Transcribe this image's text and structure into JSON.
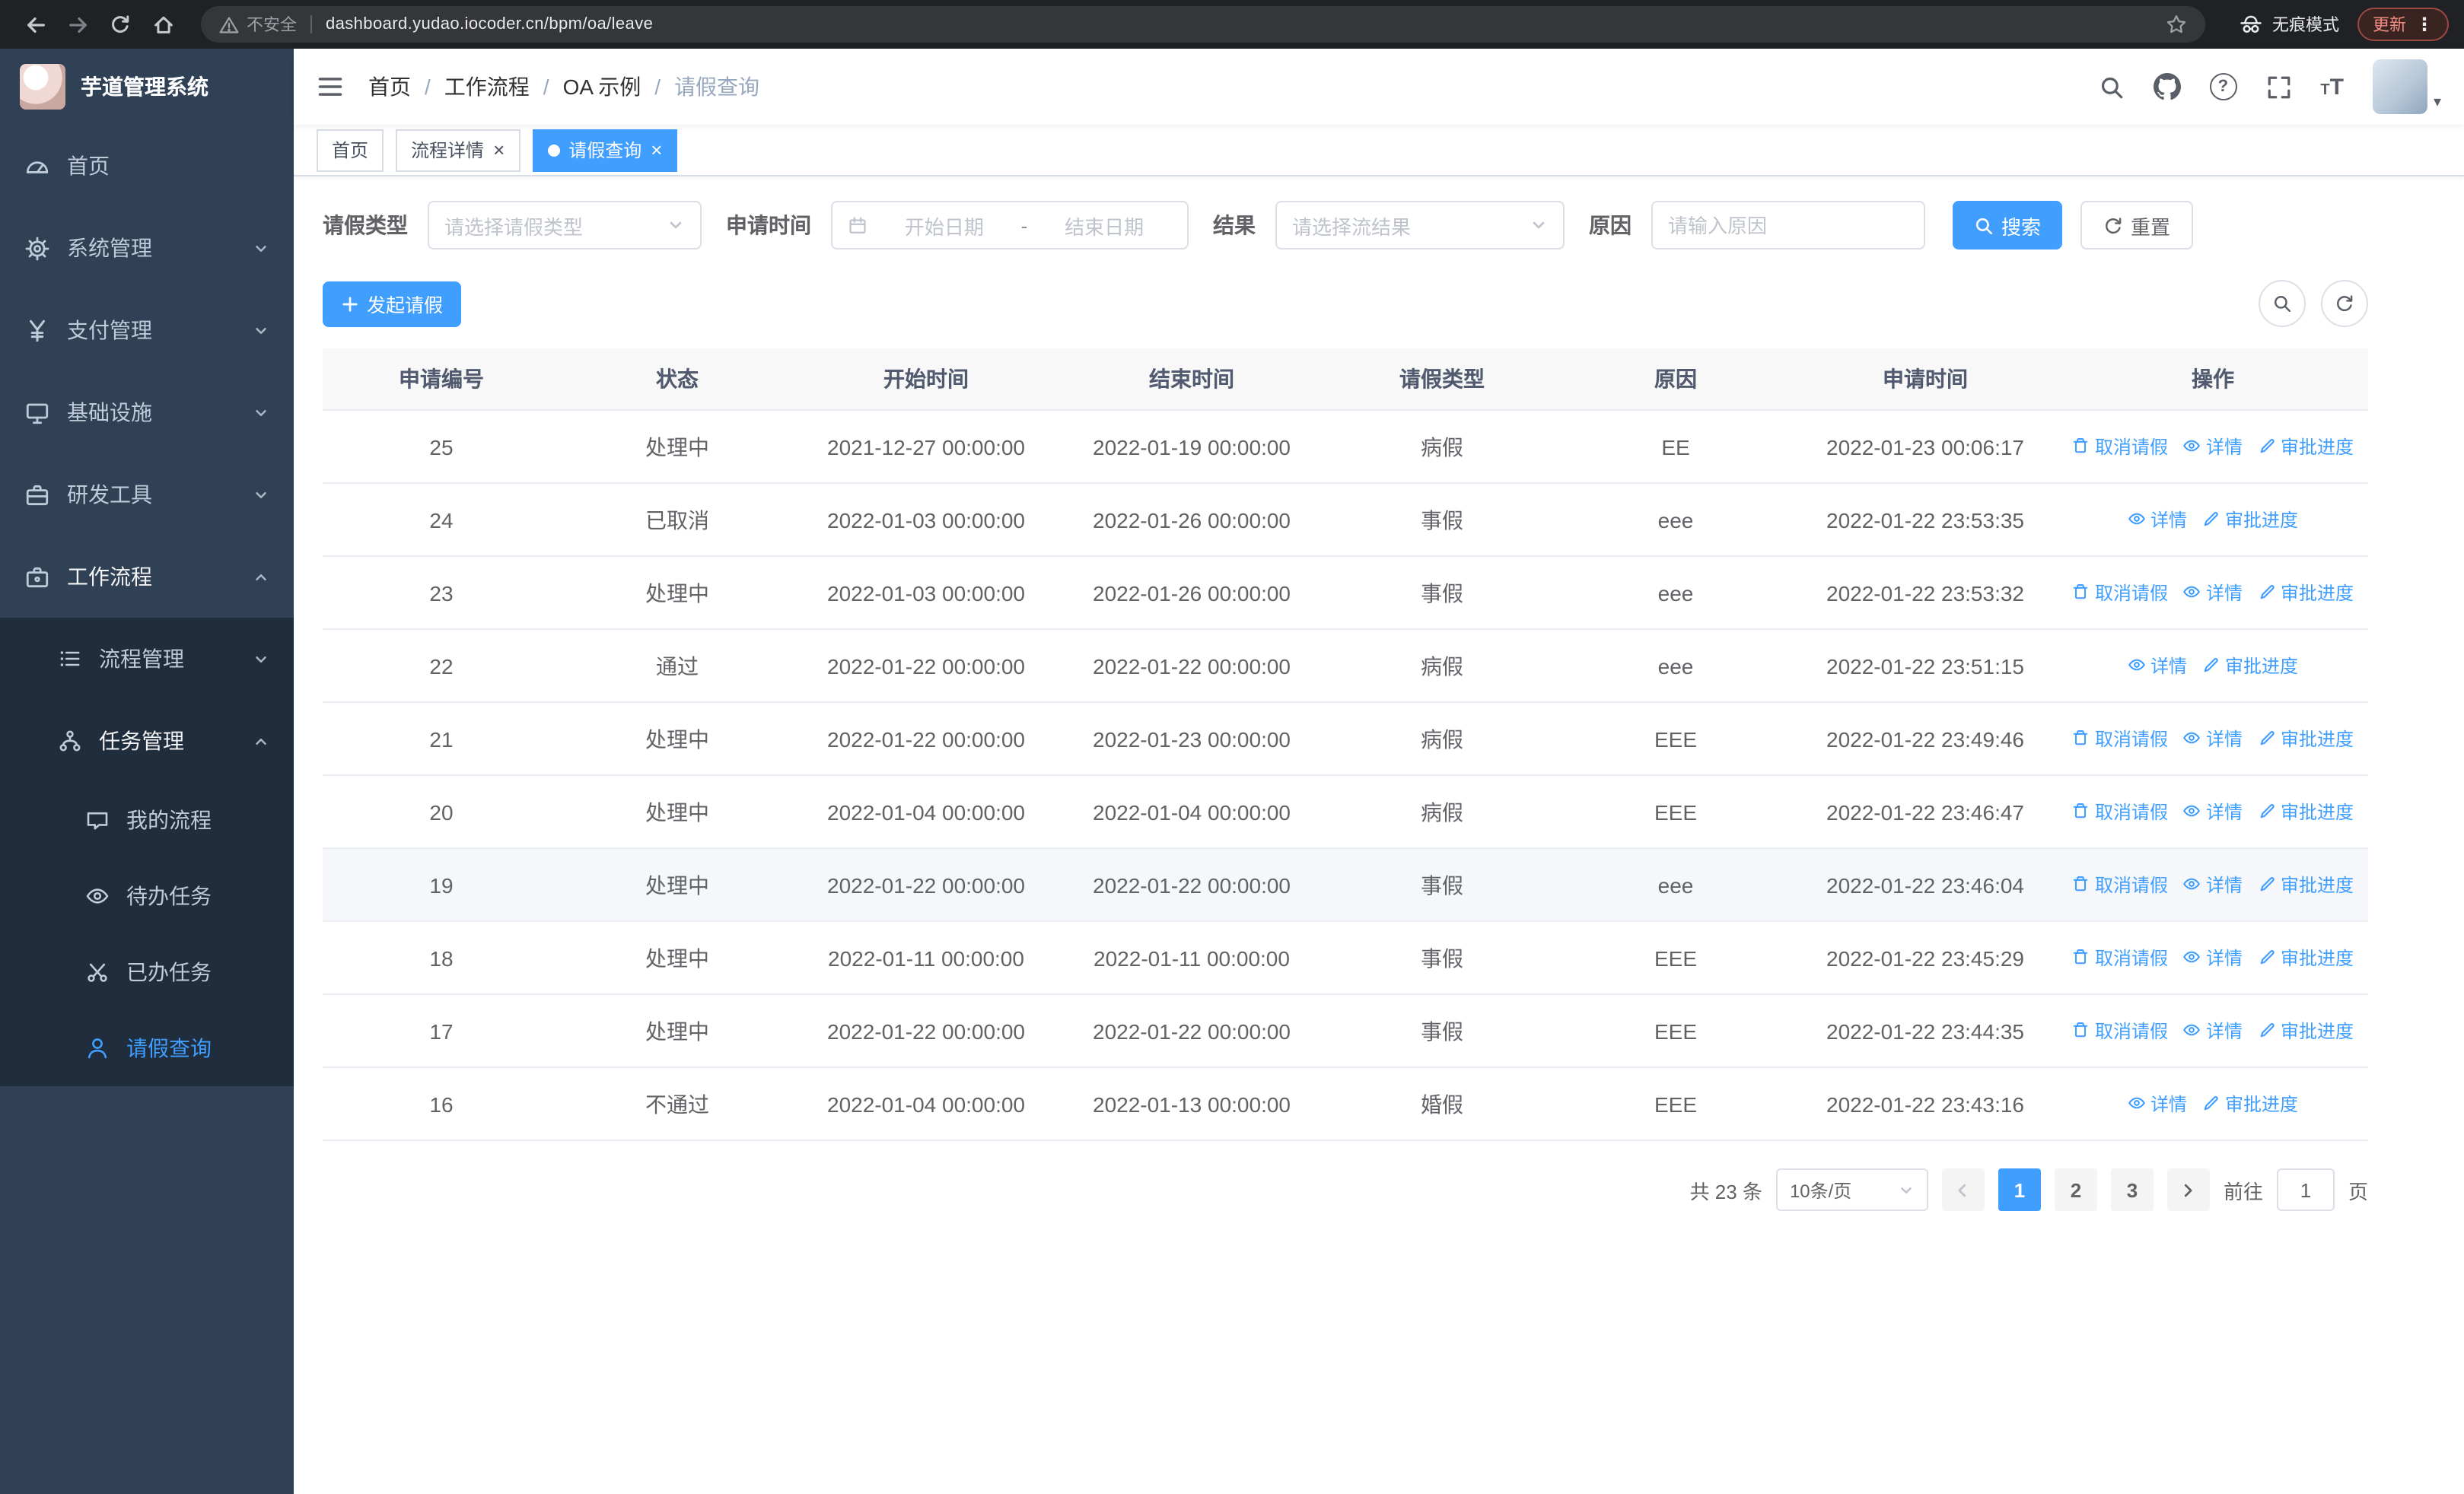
{
  "browser": {
    "security_label": "不安全",
    "url": "dashboard.yudao.iocoder.cn/bpm/oa/leave",
    "incognito_label": "无痕模式",
    "update_label": "更新"
  },
  "sidebar": {
    "logo_title": "芋道管理系统",
    "items": [
      {
        "label": "首页"
      },
      {
        "label": "系统管理"
      },
      {
        "label": "支付管理"
      },
      {
        "label": "基础设施"
      },
      {
        "label": "研发工具"
      },
      {
        "label": "工作流程",
        "children": [
          {
            "label": "流程管理"
          },
          {
            "label": "任务管理",
            "children": [
              {
                "label": "我的流程"
              },
              {
                "label": "待办任务"
              },
              {
                "label": "已办任务"
              },
              {
                "label": "请假查询"
              }
            ]
          }
        ]
      }
    ]
  },
  "header": {
    "breadcrumb": [
      "首页",
      "工作流程",
      "OA 示例",
      "请假查询"
    ]
  },
  "tabs": [
    {
      "label": "首页"
    },
    {
      "label": "流程详情"
    },
    {
      "label": "请假查询"
    }
  ],
  "filters": {
    "leave_type_label": "请假类型",
    "leave_type_placeholder": "请选择请假类型",
    "apply_time_label": "申请时间",
    "start_date_placeholder": "开始日期",
    "date_separator": "-",
    "end_date_placeholder": "结束日期",
    "result_label": "结果",
    "result_placeholder": "请选择流结果",
    "reason_label": "原因",
    "reason_placeholder": "请输入原因",
    "search_label": "搜索",
    "reset_label": "重置"
  },
  "toolbar": {
    "create_label": "发起请假"
  },
  "table": {
    "columns": [
      "申请编号",
      "状态",
      "开始时间",
      "结束时间",
      "请假类型",
      "原因",
      "申请时间",
      "操作"
    ],
    "action_labels": {
      "cancel": "取消请假",
      "detail": "详情",
      "progress": "审批进度"
    },
    "rows": [
      {
        "id": "25",
        "status": "处理中",
        "start": "2021-12-27 00:00:00",
        "end": "2022-01-19 00:00:00",
        "type": "病假",
        "reason": "EE",
        "applied": "2022-01-23 00:06:17",
        "actions": [
          "cancel",
          "detail",
          "progress"
        ],
        "highlight": false
      },
      {
        "id": "24",
        "status": "已取消",
        "start": "2022-01-03 00:00:00",
        "end": "2022-01-26 00:00:00",
        "type": "事假",
        "reason": "eee",
        "applied": "2022-01-22 23:53:35",
        "actions": [
          "detail",
          "progress"
        ],
        "highlight": false
      },
      {
        "id": "23",
        "status": "处理中",
        "start": "2022-01-03 00:00:00",
        "end": "2022-01-26 00:00:00",
        "type": "事假",
        "reason": "eee",
        "applied": "2022-01-22 23:53:32",
        "actions": [
          "cancel",
          "detail",
          "progress"
        ],
        "highlight": false
      },
      {
        "id": "22",
        "status": "通过",
        "start": "2022-01-22 00:00:00",
        "end": "2022-01-22 00:00:00",
        "type": "病假",
        "reason": "eee",
        "applied": "2022-01-22 23:51:15",
        "actions": [
          "detail",
          "progress"
        ],
        "highlight": false
      },
      {
        "id": "21",
        "status": "处理中",
        "start": "2022-01-22 00:00:00",
        "end": "2022-01-23 00:00:00",
        "type": "病假",
        "reason": "EEE",
        "applied": "2022-01-22 23:49:46",
        "actions": [
          "cancel",
          "detail",
          "progress"
        ],
        "highlight": false
      },
      {
        "id": "20",
        "status": "处理中",
        "start": "2022-01-04 00:00:00",
        "end": "2022-01-04 00:00:00",
        "type": "病假",
        "reason": "EEE",
        "applied": "2022-01-22 23:46:47",
        "actions": [
          "cancel",
          "detail",
          "progress"
        ],
        "highlight": false
      },
      {
        "id": "19",
        "status": "处理中",
        "start": "2022-01-22 00:00:00",
        "end": "2022-01-22 00:00:00",
        "type": "事假",
        "reason": "eee",
        "applied": "2022-01-22 23:46:04",
        "actions": [
          "cancel",
          "detail",
          "progress"
        ],
        "highlight": true
      },
      {
        "id": "18",
        "status": "处理中",
        "start": "2022-01-11 00:00:00",
        "end": "2022-01-11 00:00:00",
        "type": "事假",
        "reason": "EEE",
        "applied": "2022-01-22 23:45:29",
        "actions": [
          "cancel",
          "detail",
          "progress"
        ],
        "highlight": false
      },
      {
        "id": "17",
        "status": "处理中",
        "start": "2022-01-22 00:00:00",
        "end": "2022-01-22 00:00:00",
        "type": "事假",
        "reason": "EEE",
        "applied": "2022-01-22 23:44:35",
        "actions": [
          "cancel",
          "detail",
          "progress"
        ],
        "highlight": false
      },
      {
        "id": "16",
        "status": "不通过",
        "start": "2022-01-04 00:00:00",
        "end": "2022-01-13 00:00:00",
        "type": "婚假",
        "reason": "EEE",
        "applied": "2022-01-22 23:43:16",
        "actions": [
          "detail",
          "progress"
        ],
        "highlight": false
      }
    ]
  },
  "pagination": {
    "total": "共 23 条",
    "page_size": "10条/页",
    "pages": [
      "1",
      "2",
      "3"
    ],
    "active_page": "1",
    "goto_label": "前往",
    "goto_value": "1",
    "goto_suffix": "页"
  },
  "colors": {
    "accent": "#409eff",
    "sidebar_bg": "#304156",
    "submenu_bg": "#1f2d3d",
    "chrome_bg": "#202124",
    "table_header_bg": "#f8f8f9",
    "update_text": "#f28b82"
  },
  "icons": {
    "security-warning-icon": "triangle-exclamation",
    "bookmark-star-icon": "star-outline",
    "incognito-icon": "spy-hat-glasses",
    "search-icon": "magnifier",
    "github-icon": "octocat",
    "help-icon": "question-circle",
    "fullscreen-icon": "expand-corners",
    "font-size-icon": "double-T",
    "cancel-leave-icon": "trash",
    "detail-icon": "eye",
    "progress-icon": "pen",
    "calendar-icon": "calendar",
    "refresh-icon": "circular-arrow",
    "plus-icon": "plus"
  }
}
